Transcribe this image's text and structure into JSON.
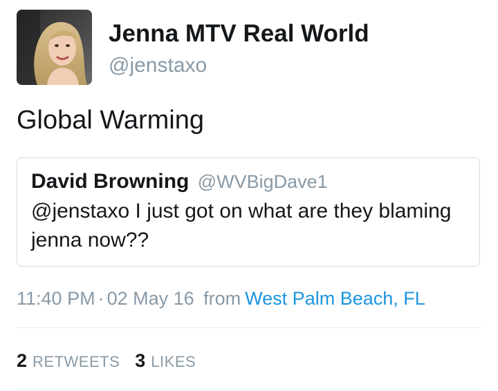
{
  "author": {
    "display_name": "Jenna MTV Real World",
    "handle": "@jenstaxo",
    "avatar_icon": "profile-photo"
  },
  "tweet": {
    "text": "Global Warming"
  },
  "quoted_tweet": {
    "display_name": "David Browning",
    "handle": "@WVBigDave1",
    "text": "@jenstaxo I just got on what are they blaming jenna now??"
  },
  "meta": {
    "time": "11:40 PM",
    "separator": "·",
    "date": "02 May 16",
    "from_label": "from",
    "location": "West Palm Beach, FL"
  },
  "stats": {
    "retweets_count": "2",
    "retweets_label": "RETWEETS",
    "likes_count": "3",
    "likes_label": "LIKES"
  },
  "colors": {
    "link": "#1b95e0",
    "secondary_text": "#8899a6",
    "primary_text": "#14171a",
    "border": "#d5dbe0"
  }
}
